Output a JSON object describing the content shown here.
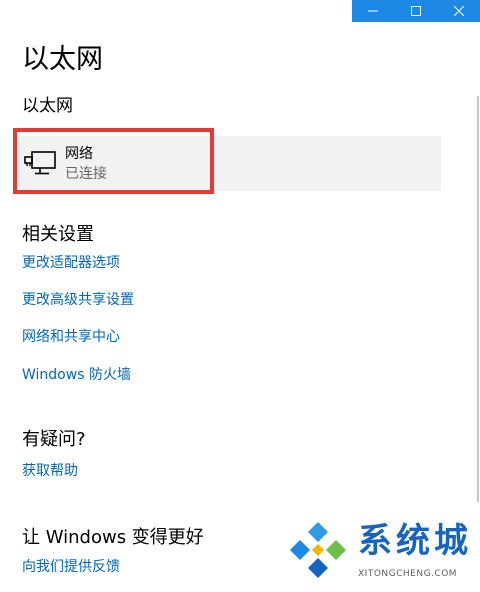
{
  "window": {
    "caption_buttons": [
      {
        "name": "minimize-button",
        "icon": "minimize-icon"
      },
      {
        "name": "maximize-button",
        "icon": "maximize-icon"
      },
      {
        "name": "close-button",
        "icon": "close-icon"
      }
    ],
    "accent": "#1e88e5"
  },
  "page": {
    "title": "以太网",
    "section_title": "以太网"
  },
  "network": {
    "name": "网络",
    "status": "已连接",
    "icon": "ethernet-monitor-icon",
    "highlight_color": "#e53935"
  },
  "related_settings": {
    "heading": "相关设置",
    "links": [
      "更改适配器选项",
      "更改高级共享设置",
      "网络和共享中心",
      "Windows 防火墙"
    ]
  },
  "help": {
    "heading": "有疑问?",
    "link": "获取帮助"
  },
  "feedback": {
    "heading": "让 Windows 变得更好",
    "link": "向我们提供反馈"
  },
  "watermark": {
    "title": "系统城",
    "url": "XITONGCHENG.COM",
    "icon": "diamond-logo-icon"
  },
  "colors": {
    "link": "#0067c0",
    "item_bg": "#f2f2f2"
  }
}
